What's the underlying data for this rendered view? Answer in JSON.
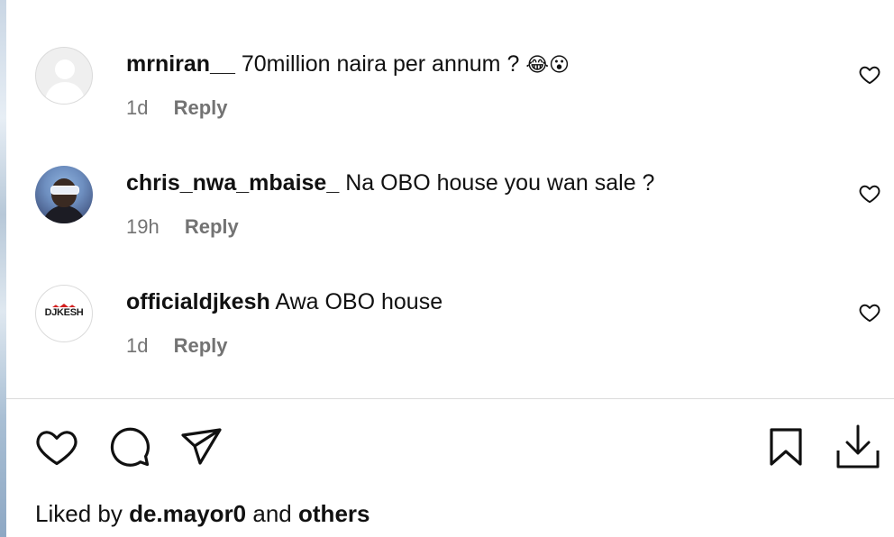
{
  "comments": [
    {
      "username": "mrniran__",
      "text": "70million naira per annum ?",
      "emoji": "😂😮",
      "time": "1d",
      "reply_label": "Reply",
      "avatar": "default-avatar"
    },
    {
      "username": "chris_nwa_mbaise_",
      "text": "Na OBO house you wan sale ?",
      "emoji": "",
      "time": "19h",
      "reply_label": "Reply",
      "avatar": "photo-avatar"
    },
    {
      "username": "officialdjkesh",
      "text": "Awa OBO house",
      "emoji": "",
      "time": "1d",
      "reply_label": "Reply",
      "avatar": "logo-avatar",
      "avatar_text": "DJKESH"
    }
  ],
  "actions": {
    "like_icon": "heart-icon",
    "comment_icon": "comment-icon",
    "share_icon": "send-icon",
    "save_icon": "bookmark-icon",
    "download_icon": "download-icon"
  },
  "liked_by": {
    "prefix": "Liked by",
    "user": "de.mayor0",
    "middle": "and",
    "others": "others"
  },
  "colors": {
    "text": "#111111",
    "muted": "#737373",
    "divider": "#dbdbdb"
  }
}
